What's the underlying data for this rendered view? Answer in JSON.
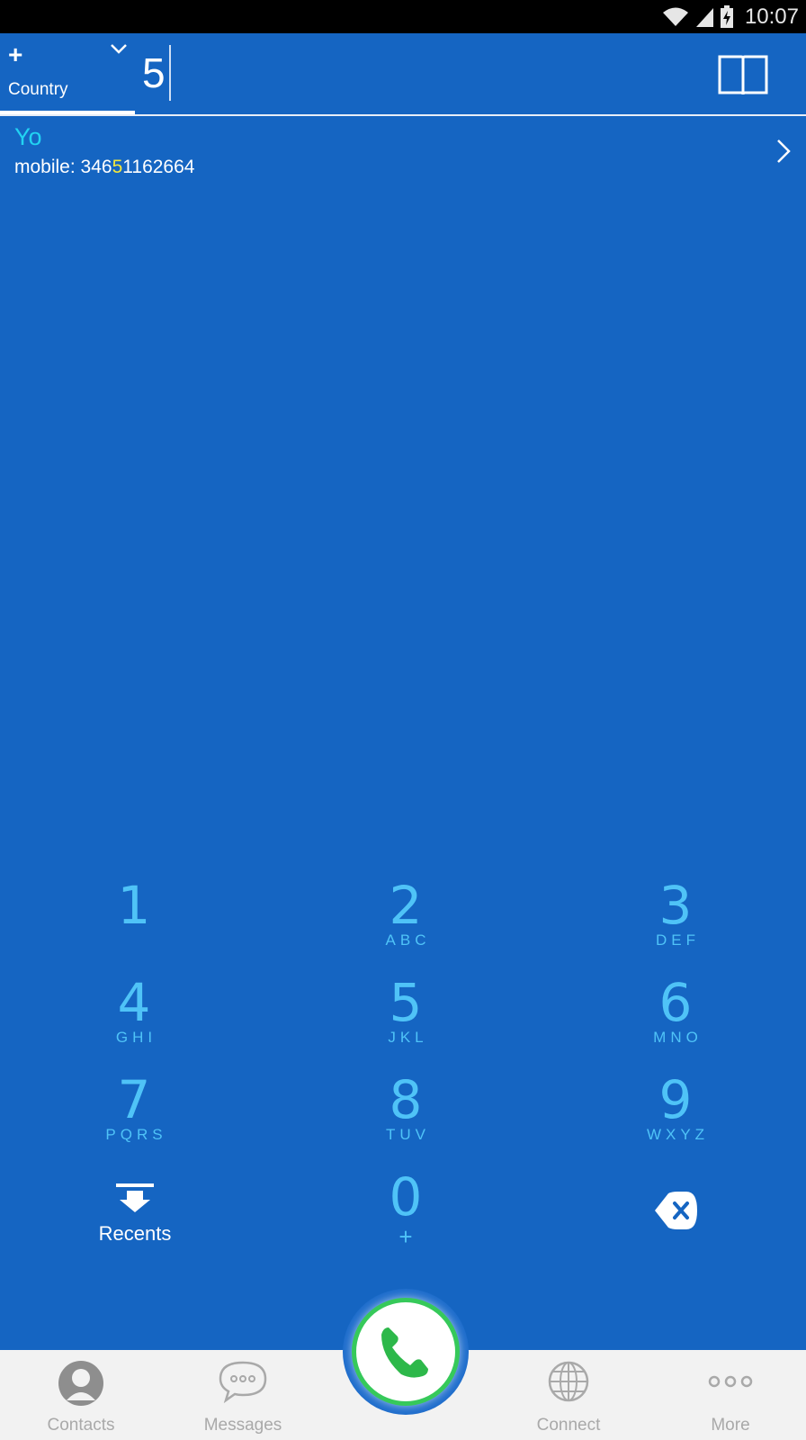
{
  "status_bar": {
    "time": "10:07"
  },
  "header": {
    "country_plus": "+",
    "country_label": "Country",
    "dial_value": "5"
  },
  "result": {
    "name": "Yo",
    "number_label": "mobile: ",
    "number_before": "346",
    "number_match": "5",
    "number_after": "1162664"
  },
  "keypad": {
    "k1": {
      "digit": "1",
      "letters": ""
    },
    "k2": {
      "digit": "2",
      "letters": "ABC"
    },
    "k3": {
      "digit": "3",
      "letters": "DEF"
    },
    "k4": {
      "digit": "4",
      "letters": "GHI"
    },
    "k5": {
      "digit": "5",
      "letters": "JKL"
    },
    "k6": {
      "digit": "6",
      "letters": "MNO"
    },
    "k7": {
      "digit": "7",
      "letters": "PQRS"
    },
    "k8": {
      "digit": "8",
      "letters": "TUV"
    },
    "k9": {
      "digit": "9",
      "letters": "WXYZ"
    },
    "k0": {
      "digit": "0",
      "letters": "+"
    },
    "recents_label": "Recents"
  },
  "bottom_nav": {
    "contacts": "Contacts",
    "messages": "Messages",
    "connect": "Connect",
    "more": "More"
  },
  "colors": {
    "background": "#1565c2",
    "keypad_digit": "#4fc3f7",
    "match_highlight": "#f4e83b",
    "name": "#22d3f2",
    "call_green": "#36c95a"
  },
  "icons": [
    "wifi-icon",
    "signal-icon",
    "battery-icon",
    "chevron-down-icon",
    "book-icon",
    "chevron-right-icon",
    "recents-down-icon",
    "backspace-icon",
    "contacts-icon",
    "messages-icon",
    "phone-icon",
    "globe-icon",
    "more-icon"
  ]
}
